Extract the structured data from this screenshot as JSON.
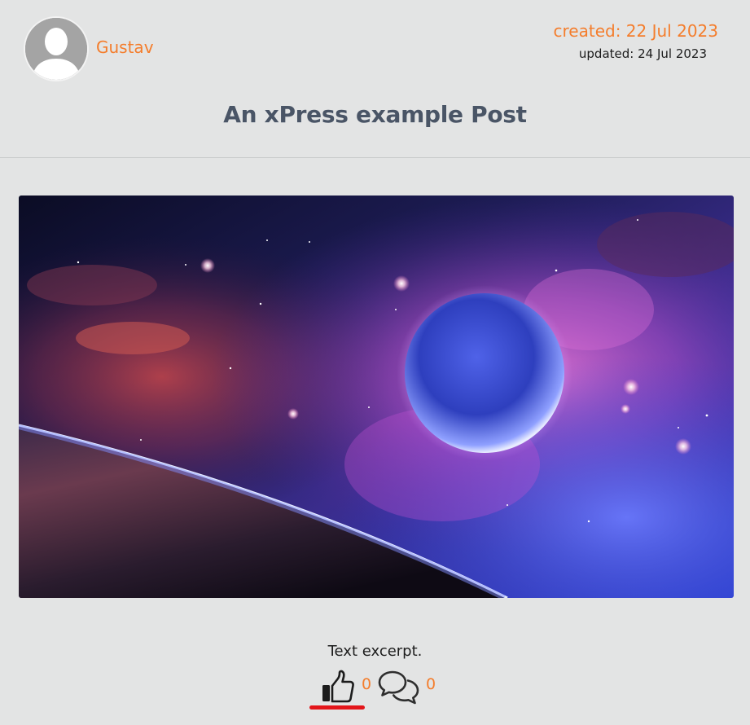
{
  "post": {
    "author": "Gustav",
    "created": "created: 22 Jul 2023",
    "updated": "updated: 24 Jul 2023",
    "title": "An xPress example Post",
    "excerpt": "Text excerpt.",
    "likes": "0",
    "comments": "0"
  },
  "icons": {
    "avatar": "default-user-avatar",
    "like": "thumbs-up-icon",
    "comment": "comments-icon"
  },
  "colors": {
    "accent": "#f47d2c",
    "title": "#4a5566",
    "background": "#e3e4e4",
    "like_indicator": "#e3151a"
  }
}
